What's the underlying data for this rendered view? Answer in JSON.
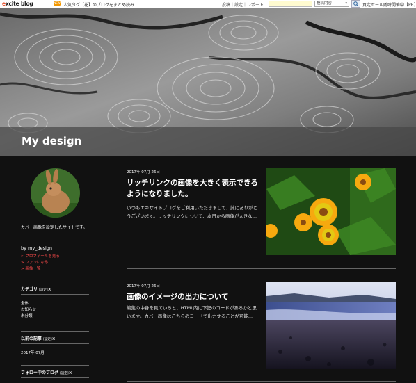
{
  "topbar": {
    "logo_prefix": "e",
    "logo_rest": "xcite blog",
    "new_badge": "NEW",
    "popular_text": "人気タグ【花】のブログをまとめ読み",
    "links": "投稿｜設定｜レポート",
    "search_select": "投稿内容",
    "ad_text": "買定セール随時開催中【PR】"
  },
  "blog": {
    "title": "My design"
  },
  "sidebar": {
    "description": "カバー画像を設定したサイトです。",
    "by_line": "by my_design",
    "profile_link": "> プロフィールを見る",
    "fan_link": "> ファンになる",
    "images_link": "> 画像一覧",
    "category_heading": "カテゴリ",
    "set_label": "[設定]",
    "categories": [
      "全体",
      "お知らせ",
      "未分類"
    ],
    "archive_heading": "以前の記事",
    "archive_items": [
      "2017年 07月"
    ],
    "following_heading": "フォロー中のブログ"
  },
  "posts": [
    {
      "date": "2017年 07月 26日",
      "title": "リッチリンクの画像を大きく表示できるようになりました。",
      "excerpt": "いつもエキサイトブログをご利用いただきまして、誠にありがとうございます。リッチリンクについて、本日から画像が大きな..."
    },
    {
      "date": "2017年 07月 26日",
      "title": "画像のイメージの出力について",
      "excerpt": "編集の中身を見ていると、HTML内に下記のコードがあるかと思います。カバー画像はこちらのコードで出力することが可能..."
    }
  ]
}
